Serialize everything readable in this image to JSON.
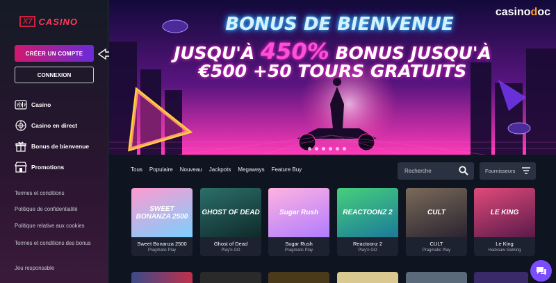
{
  "sidebar": {
    "logo_mark": "X7",
    "logo_word": "CASINO",
    "create_account": "CRÉER UN COMPTE",
    "login": "CONNEXION",
    "nav": [
      {
        "label": "Casino",
        "icon": "slot-machine-icon"
      },
      {
        "label": "Casino en direct",
        "icon": "roulette-icon"
      },
      {
        "label": "Bonus de bienvenue",
        "icon": "gift-icon"
      },
      {
        "label": "Promotions",
        "icon": "shop-icon"
      }
    ],
    "links": [
      "Termes et conditions",
      "Politique de confidentialité",
      "Politique relative aux cookies",
      "Termes et conditions des bonus",
      "Jeu responsable"
    ]
  },
  "banner": {
    "line1": "BONUS DE BIENVENUE",
    "line2_pre": "JUSQU'À ",
    "line2_big": "450%",
    "line2_post": " BONUS JUSQU'À",
    "line3": "€500 +50 TOURS GRATUITS",
    "partner_a": "casino",
    "partner_o": "d",
    "partner_b": "oc"
  },
  "filters": [
    "Tous",
    "Populaire",
    "Nouveau",
    "Jackpots",
    "Megaways",
    "Feature Buy"
  ],
  "search": {
    "placeholder": "Recherche"
  },
  "provider_filter": {
    "label": "Fournisseurs"
  },
  "games": [
    {
      "name": "Sweet Bonanza 2500",
      "provider": "Pragmatic Play",
      "thumb": "SWEET BONANZA 2500",
      "color1": "#ff9ad0",
      "color2": "#7ad0ff"
    },
    {
      "name": "Ghost of Dead",
      "provider": "Play'n GO",
      "thumb": "GHOST OF DEAD",
      "color1": "#2b6f6a",
      "color2": "#0f2a2a"
    },
    {
      "name": "Sugar Rush",
      "provider": "Pragmatic Play",
      "thumb": "Sugar Rush",
      "color1": "#ffb3e0",
      "color2": "#b07cff"
    },
    {
      "name": "Reactoonz 2",
      "provider": "Play'n GO",
      "thumb": "REACTOONZ 2",
      "color1": "#47d07a",
      "color2": "#1a7a9a"
    },
    {
      "name": "CULT",
      "provider": "Pragmatic Play",
      "thumb": "CULT",
      "color1": "#7a6a5a",
      "color2": "#2a2430"
    },
    {
      "name": "Le King",
      "provider": "Hacksaw Gaming",
      "thumb": "LE KING",
      "color1": "#e04a7a",
      "color2": "#5a1a4a"
    }
  ],
  "colors": {
    "accent_pink": "#d0196e",
    "accent_purple": "#6a2bd8",
    "logo_red": "#d1213c",
    "chat": "#7c4dff"
  }
}
